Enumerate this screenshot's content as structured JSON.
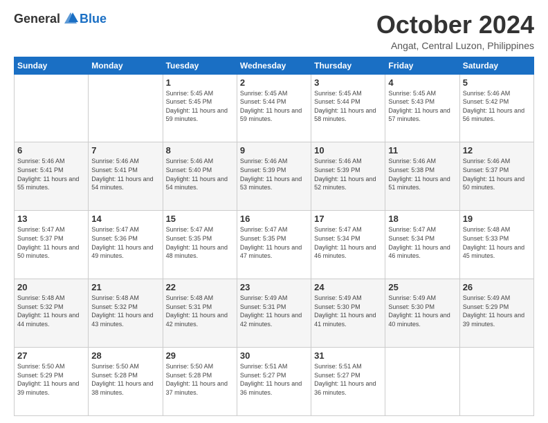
{
  "logo": {
    "general": "General",
    "blue": "Blue"
  },
  "header": {
    "month": "October 2024",
    "location": "Angat, Central Luzon, Philippines"
  },
  "weekdays": [
    "Sunday",
    "Monday",
    "Tuesday",
    "Wednesday",
    "Thursday",
    "Friday",
    "Saturday"
  ],
  "weeks": [
    [
      {
        "day": "",
        "sunrise": "",
        "sunset": "",
        "daylight": ""
      },
      {
        "day": "",
        "sunrise": "",
        "sunset": "",
        "daylight": ""
      },
      {
        "day": "1",
        "sunrise": "Sunrise: 5:45 AM",
        "sunset": "Sunset: 5:45 PM",
        "daylight": "Daylight: 11 hours and 59 minutes."
      },
      {
        "day": "2",
        "sunrise": "Sunrise: 5:45 AM",
        "sunset": "Sunset: 5:44 PM",
        "daylight": "Daylight: 11 hours and 59 minutes."
      },
      {
        "day": "3",
        "sunrise": "Sunrise: 5:45 AM",
        "sunset": "Sunset: 5:44 PM",
        "daylight": "Daylight: 11 hours and 58 minutes."
      },
      {
        "day": "4",
        "sunrise": "Sunrise: 5:45 AM",
        "sunset": "Sunset: 5:43 PM",
        "daylight": "Daylight: 11 hours and 57 minutes."
      },
      {
        "day": "5",
        "sunrise": "Sunrise: 5:46 AM",
        "sunset": "Sunset: 5:42 PM",
        "daylight": "Daylight: 11 hours and 56 minutes."
      }
    ],
    [
      {
        "day": "6",
        "sunrise": "Sunrise: 5:46 AM",
        "sunset": "Sunset: 5:41 PM",
        "daylight": "Daylight: 11 hours and 55 minutes."
      },
      {
        "day": "7",
        "sunrise": "Sunrise: 5:46 AM",
        "sunset": "Sunset: 5:41 PM",
        "daylight": "Daylight: 11 hours and 54 minutes."
      },
      {
        "day": "8",
        "sunrise": "Sunrise: 5:46 AM",
        "sunset": "Sunset: 5:40 PM",
        "daylight": "Daylight: 11 hours and 54 minutes."
      },
      {
        "day": "9",
        "sunrise": "Sunrise: 5:46 AM",
        "sunset": "Sunset: 5:39 PM",
        "daylight": "Daylight: 11 hours and 53 minutes."
      },
      {
        "day": "10",
        "sunrise": "Sunrise: 5:46 AM",
        "sunset": "Sunset: 5:39 PM",
        "daylight": "Daylight: 11 hours and 52 minutes."
      },
      {
        "day": "11",
        "sunrise": "Sunrise: 5:46 AM",
        "sunset": "Sunset: 5:38 PM",
        "daylight": "Daylight: 11 hours and 51 minutes."
      },
      {
        "day": "12",
        "sunrise": "Sunrise: 5:46 AM",
        "sunset": "Sunset: 5:37 PM",
        "daylight": "Daylight: 11 hours and 50 minutes."
      }
    ],
    [
      {
        "day": "13",
        "sunrise": "Sunrise: 5:47 AM",
        "sunset": "Sunset: 5:37 PM",
        "daylight": "Daylight: 11 hours and 50 minutes."
      },
      {
        "day": "14",
        "sunrise": "Sunrise: 5:47 AM",
        "sunset": "Sunset: 5:36 PM",
        "daylight": "Daylight: 11 hours and 49 minutes."
      },
      {
        "day": "15",
        "sunrise": "Sunrise: 5:47 AM",
        "sunset": "Sunset: 5:35 PM",
        "daylight": "Daylight: 11 hours and 48 minutes."
      },
      {
        "day": "16",
        "sunrise": "Sunrise: 5:47 AM",
        "sunset": "Sunset: 5:35 PM",
        "daylight": "Daylight: 11 hours and 47 minutes."
      },
      {
        "day": "17",
        "sunrise": "Sunrise: 5:47 AM",
        "sunset": "Sunset: 5:34 PM",
        "daylight": "Daylight: 11 hours and 46 minutes."
      },
      {
        "day": "18",
        "sunrise": "Sunrise: 5:47 AM",
        "sunset": "Sunset: 5:34 PM",
        "daylight": "Daylight: 11 hours and 46 minutes."
      },
      {
        "day": "19",
        "sunrise": "Sunrise: 5:48 AM",
        "sunset": "Sunset: 5:33 PM",
        "daylight": "Daylight: 11 hours and 45 minutes."
      }
    ],
    [
      {
        "day": "20",
        "sunrise": "Sunrise: 5:48 AM",
        "sunset": "Sunset: 5:32 PM",
        "daylight": "Daylight: 11 hours and 44 minutes."
      },
      {
        "day": "21",
        "sunrise": "Sunrise: 5:48 AM",
        "sunset": "Sunset: 5:32 PM",
        "daylight": "Daylight: 11 hours and 43 minutes."
      },
      {
        "day": "22",
        "sunrise": "Sunrise: 5:48 AM",
        "sunset": "Sunset: 5:31 PM",
        "daylight": "Daylight: 11 hours and 42 minutes."
      },
      {
        "day": "23",
        "sunrise": "Sunrise: 5:49 AM",
        "sunset": "Sunset: 5:31 PM",
        "daylight": "Daylight: 11 hours and 42 minutes."
      },
      {
        "day": "24",
        "sunrise": "Sunrise: 5:49 AM",
        "sunset": "Sunset: 5:30 PM",
        "daylight": "Daylight: 11 hours and 41 minutes."
      },
      {
        "day": "25",
        "sunrise": "Sunrise: 5:49 AM",
        "sunset": "Sunset: 5:30 PM",
        "daylight": "Daylight: 11 hours and 40 minutes."
      },
      {
        "day": "26",
        "sunrise": "Sunrise: 5:49 AM",
        "sunset": "Sunset: 5:29 PM",
        "daylight": "Daylight: 11 hours and 39 minutes."
      }
    ],
    [
      {
        "day": "27",
        "sunrise": "Sunrise: 5:50 AM",
        "sunset": "Sunset: 5:29 PM",
        "daylight": "Daylight: 11 hours and 39 minutes."
      },
      {
        "day": "28",
        "sunrise": "Sunrise: 5:50 AM",
        "sunset": "Sunset: 5:28 PM",
        "daylight": "Daylight: 11 hours and 38 minutes."
      },
      {
        "day": "29",
        "sunrise": "Sunrise: 5:50 AM",
        "sunset": "Sunset: 5:28 PM",
        "daylight": "Daylight: 11 hours and 37 minutes."
      },
      {
        "day": "30",
        "sunrise": "Sunrise: 5:51 AM",
        "sunset": "Sunset: 5:27 PM",
        "daylight": "Daylight: 11 hours and 36 minutes."
      },
      {
        "day": "31",
        "sunrise": "Sunrise: 5:51 AM",
        "sunset": "Sunset: 5:27 PM",
        "daylight": "Daylight: 11 hours and 36 minutes."
      },
      {
        "day": "",
        "sunrise": "",
        "sunset": "",
        "daylight": ""
      },
      {
        "day": "",
        "sunrise": "",
        "sunset": "",
        "daylight": ""
      }
    ]
  ]
}
